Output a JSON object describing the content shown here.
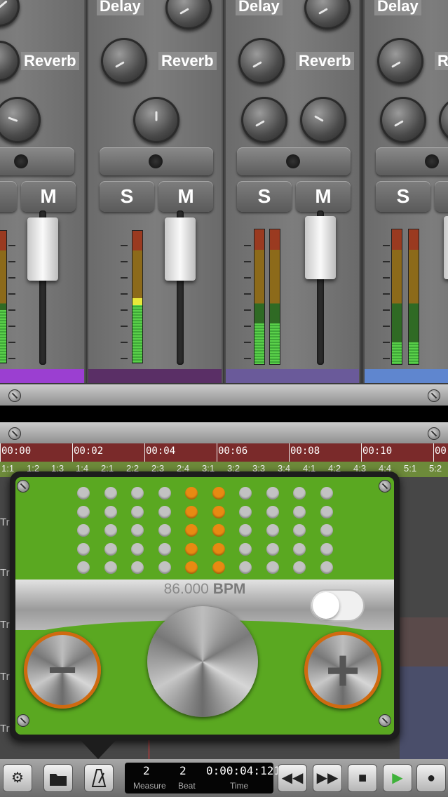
{
  "mixer": {
    "strips": [
      {
        "delay_label": "",
        "reverb_label": "Reverb",
        "solo_label": "",
        "mute_label": "M",
        "color": "#9b3fd1"
      },
      {
        "delay_label": "Delay",
        "reverb_label": "Reverb",
        "solo_label": "S",
        "mute_label": "M",
        "color": "#5a2f66"
      },
      {
        "delay_label": "Delay",
        "reverb_label": "Reverb",
        "solo_label": "S",
        "mute_label": "M",
        "color": "#6a5a9a"
      },
      {
        "delay_label": "Delay",
        "reverb_label": "R",
        "solo_label": "S",
        "mute_label": "",
        "color": "#5f86cf"
      }
    ]
  },
  "timeline": {
    "times": [
      "00:00",
      "00:02",
      "00:04",
      "00:06",
      "00:08",
      "00:10",
      "00:"
    ],
    "beats": [
      "1:1",
      "1:2",
      "1:3",
      "1:4",
      "2:1",
      "2:2",
      "2:3",
      "2:4",
      "3:1",
      "3:2",
      "3:3",
      "3:4",
      "4:1",
      "4:2",
      "4:3",
      "4:4",
      "5:1",
      "5:2"
    ],
    "track_labels": [
      "Tr",
      "Tr",
      "Tr",
      "Tr",
      "Tr"
    ]
  },
  "metronome": {
    "bpm_value": "86.000",
    "bpm_unit": "BPM",
    "minus_label": "−",
    "plus_label": "+",
    "toggle_on": false,
    "active_column": [
      5,
      6
    ],
    "accent_color": "#e88a12"
  },
  "transport": {
    "measure_value": "2",
    "measure_label": "Measure",
    "beat_value": "2",
    "beat_label": "Beat",
    "time_value": "0:00:04:121",
    "time_label": "Time"
  }
}
